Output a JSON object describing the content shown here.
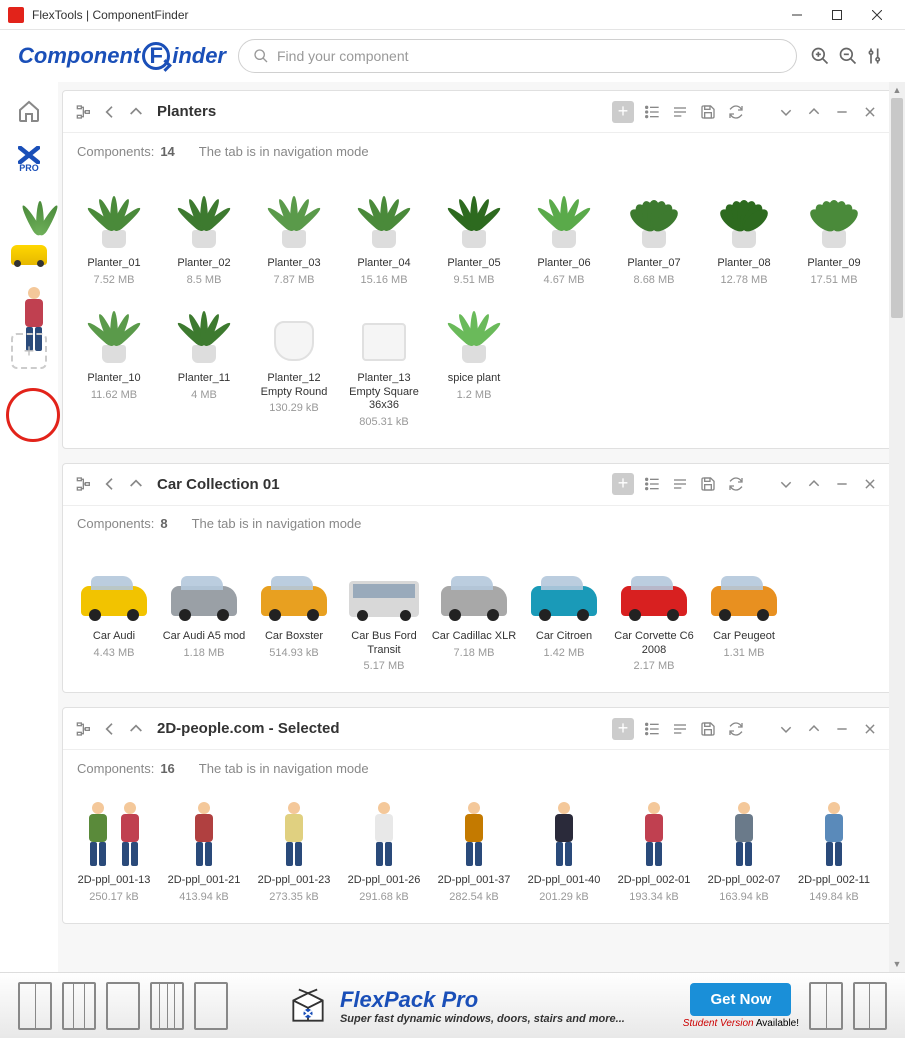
{
  "window": {
    "title": "FlexTools | ComponentFinder"
  },
  "brand": {
    "part1": "Component",
    "part2_letter": "F",
    "part3": "inder"
  },
  "search": {
    "placeholder": "Find your component"
  },
  "sidebar": {
    "pro_label": "PRO",
    "add_label": "+"
  },
  "panels": [
    {
      "title": "Planters",
      "components_label": "Components:",
      "count": "14",
      "mode_text": "The tab is in navigation mode",
      "items": [
        {
          "name": "Planter_01",
          "size": "7.52 MB",
          "vis": "plant",
          "color": "#4a8a3a"
        },
        {
          "name": "Planter_02",
          "size": "8.5 MB",
          "vis": "plant",
          "color": "#3d7a2f"
        },
        {
          "name": "Planter_03",
          "size": "7.87 MB",
          "vis": "plant",
          "color": "#5a9a4a"
        },
        {
          "name": "Planter_04",
          "size": "15.16 MB",
          "vis": "plant",
          "color": "#4a8a3a"
        },
        {
          "name": "Planter_05",
          "size": "9.51 MB",
          "vis": "plant",
          "color": "#2d6a1f"
        },
        {
          "name": "Planter_06",
          "size": "4.67 MB",
          "vis": "plant",
          "color": "#5aaa4a"
        },
        {
          "name": "Planter_07",
          "size": "8.68 MB",
          "vis": "bushy",
          "color": "#3d7a2f"
        },
        {
          "name": "Planter_08",
          "size": "12.78 MB",
          "vis": "bushy",
          "color": "#2d6a1f"
        },
        {
          "name": "Planter_09",
          "size": "17.51 MB",
          "vis": "bushy",
          "color": "#4a8a3a"
        },
        {
          "name": "Planter_10",
          "size": "11.62 MB",
          "vis": "plant",
          "color": "#5a9a4a"
        },
        {
          "name": "Planter_11",
          "size": "4 MB",
          "vis": "plant",
          "color": "#3d7a2f"
        },
        {
          "name": "Planter_12 Empty Round",
          "size": "130.29 kB",
          "vis": "emptypot"
        },
        {
          "name": "Planter_13 Empty Square 36x36",
          "size": "805.31 kB",
          "vis": "sqpot"
        },
        {
          "name": "spice plant",
          "size": "1.2 MB",
          "vis": "plant",
          "color": "#6aba5a"
        }
      ]
    },
    {
      "title": "Car Collection 01",
      "components_label": "Components:",
      "count": "8",
      "mode_text": "The tab is in navigation mode",
      "items": [
        {
          "name": "Car Audi",
          "size": "4.43 MB",
          "vis": "car",
          "color": "#f2c300"
        },
        {
          "name": "Car Audi A5 mod",
          "size": "1.18 MB",
          "vis": "car",
          "color": "#9aa0a6"
        },
        {
          "name": "Car Boxster",
          "size": "514.93 kB",
          "vis": "car",
          "color": "#e8a020"
        },
        {
          "name": "Car Bus Ford Transit",
          "size": "5.17 MB",
          "vis": "bus"
        },
        {
          "name": "Car Cadillac XLR",
          "size": "7.18 MB",
          "vis": "car",
          "color": "#a8a8a8"
        },
        {
          "name": "Car Citroen",
          "size": "1.42 MB",
          "vis": "car",
          "color": "#1a9ab8"
        },
        {
          "name": "Car Corvette C6 2008",
          "size": "2.17 MB",
          "vis": "car",
          "color": "#d82020"
        },
        {
          "name": "Car Peugeot",
          "size": "1.31 MB",
          "vis": "car",
          "color": "#e89020"
        }
      ]
    },
    {
      "title": "2D-people.com - Selected",
      "components_label": "Components:",
      "count": "16",
      "mode_text": "The tab is in navigation mode",
      "items": [
        {
          "name": "2D-ppl_001-13",
          "size": "250.17 kB",
          "vis": "person",
          "body": "#5a8a3a",
          "pair": true
        },
        {
          "name": "2D-ppl_001-21",
          "size": "413.94 kB",
          "vis": "person",
          "body": "#b04040"
        },
        {
          "name": "2D-ppl_001-23",
          "size": "273.35 kB",
          "vis": "person",
          "body": "#e0d080"
        },
        {
          "name": "2D-ppl_001-26",
          "size": "291.68 kB",
          "vis": "person",
          "body": "#e8e8e8"
        },
        {
          "name": "2D-ppl_001-37",
          "size": "282.54 kB",
          "vis": "person",
          "body": "#c47a00"
        },
        {
          "name": "2D-ppl_001-40",
          "size": "201.29 kB",
          "vis": "person",
          "body": "#2a2a3a"
        },
        {
          "name": "2D-ppl_002-01",
          "size": "193.34 kB",
          "vis": "person",
          "body": "#c04050"
        },
        {
          "name": "2D-ppl_002-07",
          "size": "163.94 kB",
          "vis": "person",
          "body": "#6a7a8a"
        },
        {
          "name": "2D-ppl_002-11",
          "size": "149.84 kB",
          "vis": "person",
          "body": "#5a8aba"
        }
      ]
    }
  ],
  "ad": {
    "title": "FlexPack Pro",
    "subtitle": "Super fast dynamic windows, doors, stairs and more...",
    "cta": "Get Now",
    "student_version": "Student Version",
    "available": " Available!"
  }
}
